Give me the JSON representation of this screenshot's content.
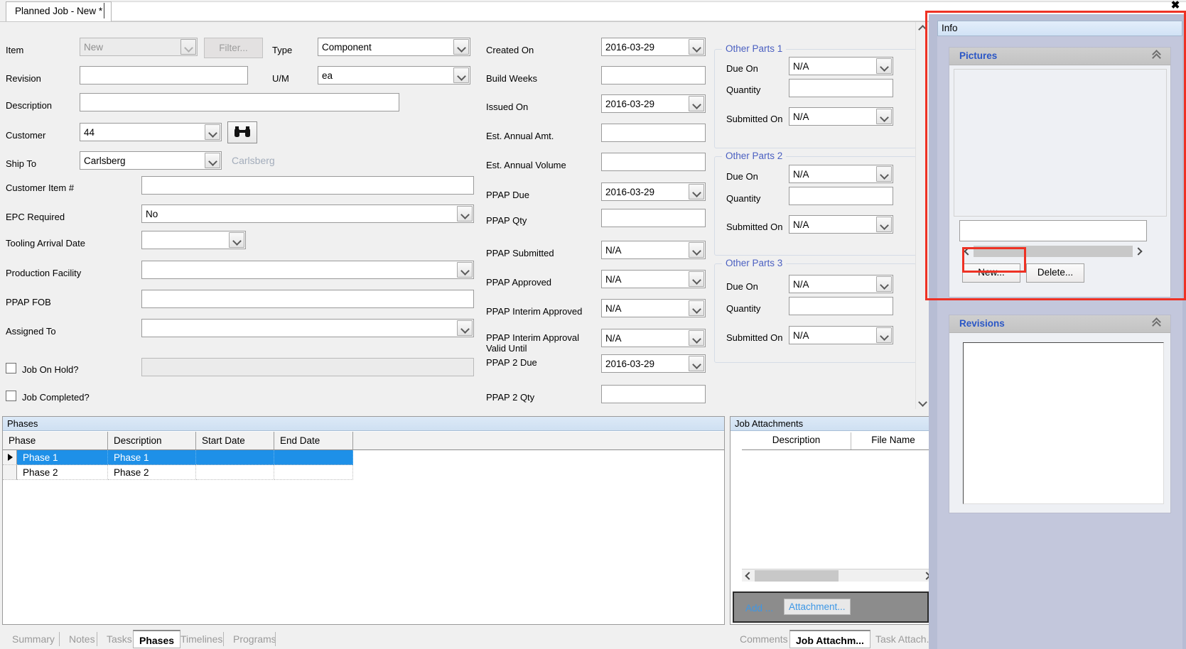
{
  "window": {
    "tab_title": "Planned Job - New *",
    "close_icon": "close-icon"
  },
  "form": {
    "left_fields": [
      {
        "label": "Item",
        "value": "New",
        "type": "combo",
        "disabled": true
      },
      {
        "label": "Revision",
        "value": "",
        "type": "text"
      },
      {
        "label": "Description",
        "value": "",
        "type": "text"
      },
      {
        "label": "Customer",
        "value": "44",
        "type": "combo"
      },
      {
        "label": "Ship To",
        "value": "Carlsberg",
        "type": "combo"
      },
      {
        "label": "Customer Item #",
        "value": "",
        "type": "text"
      },
      {
        "label": "EPC Required",
        "value": "No",
        "type": "combo"
      },
      {
        "label": "Tooling Arrival Date",
        "value": "",
        "type": "combo"
      },
      {
        "label": "Production Facility",
        "value": "",
        "type": "combo"
      },
      {
        "label": "PPAP FOB",
        "value": "",
        "type": "text"
      },
      {
        "label": "Assigned To",
        "value": "",
        "type": "combo"
      },
      {
        "label": "Job On Hold?",
        "value": "",
        "type": "checkbox"
      },
      {
        "label": "Job Completed?",
        "value": "",
        "type": "checkbox"
      }
    ],
    "filter_button": "Filter...",
    "ship_to_hint": "Carlsberg",
    "find_icon": "binoculars-icon",
    "mid_fields": [
      {
        "label": "Type",
        "value": "Component",
        "type": "combo"
      },
      {
        "label": "U/M",
        "value": "ea",
        "type": "combo"
      }
    ],
    "right_fields": [
      {
        "label": "Created On",
        "value": "2016-03-29",
        "type": "combo"
      },
      {
        "label": "Build Weeks",
        "value": "",
        "type": "text"
      },
      {
        "label": "Issued On",
        "value": "2016-03-29",
        "type": "combo"
      },
      {
        "label": "Est. Annual Amt.",
        "value": "",
        "type": "text"
      },
      {
        "label": "Est. Annual Volume",
        "value": "",
        "type": "text"
      },
      {
        "label": "PPAP Due",
        "value": "2016-03-29",
        "type": "combo"
      },
      {
        "label": "PPAP Qty",
        "value": "",
        "type": "text"
      },
      {
        "label": "PPAP Submitted",
        "value": "N/A",
        "type": "combo"
      },
      {
        "label": "PPAP Approved",
        "value": "N/A",
        "type": "combo"
      },
      {
        "label": "PPAP Interim Approved",
        "value": "N/A",
        "type": "combo"
      },
      {
        "label": "PPAP Interim Approval Valid Until",
        "value": "N/A",
        "type": "combo"
      },
      {
        "label": "PPAP 2 Due",
        "value": "2016-03-29",
        "type": "combo"
      },
      {
        "label": "PPAP 2 Qty",
        "value": "",
        "type": "text"
      }
    ],
    "other_parts": [
      {
        "title": "Other Parts 1",
        "rows": [
          {
            "label": "Due On",
            "value": "N/A",
            "type": "combo"
          },
          {
            "label": "Quantity",
            "value": "",
            "type": "text"
          },
          {
            "label": "Submitted On",
            "value": "N/A",
            "type": "combo"
          }
        ]
      },
      {
        "title": "Other Parts 2",
        "rows": [
          {
            "label": "Due On",
            "value": "N/A",
            "type": "combo"
          },
          {
            "label": "Quantity",
            "value": "",
            "type": "text"
          },
          {
            "label": "Submitted On",
            "value": "N/A",
            "type": "combo"
          }
        ]
      },
      {
        "title": "Other Parts 3",
        "rows": [
          {
            "label": "Due On",
            "value": "N/A",
            "type": "combo"
          },
          {
            "label": "Quantity",
            "value": "",
            "type": "text"
          },
          {
            "label": "Submitted On",
            "value": "N/A",
            "type": "combo"
          }
        ]
      }
    ]
  },
  "phases": {
    "caption": "Phases",
    "columns": [
      "Phase",
      "Description",
      "Start Date",
      "End Date"
    ],
    "rows": [
      {
        "phase": "Phase 1",
        "description": "Phase 1",
        "start_date": "",
        "end_date": "",
        "selected": true
      },
      {
        "phase": "Phase 2",
        "description": "Phase 2",
        "start_date": "",
        "end_date": "",
        "selected": false
      }
    ],
    "tabs": [
      {
        "label": "Summary",
        "active": false
      },
      {
        "label": "Notes",
        "active": false
      },
      {
        "label": "Tasks",
        "active": false
      },
      {
        "label": "Phases",
        "active": true
      },
      {
        "label": "Timelines",
        "active": false
      },
      {
        "label": "Programs",
        "active": false
      }
    ]
  },
  "job_attachments": {
    "caption": "Job Attachments",
    "columns": [
      "Description",
      "File Name"
    ],
    "rows": [],
    "footer_buttons": [
      "Add ...",
      "Attachment..."
    ],
    "tabs": [
      {
        "label": "Comments",
        "active": false
      },
      {
        "label": "Job Attachm...",
        "active": true
      },
      {
        "label": "Task Attach...",
        "active": false
      }
    ]
  },
  "info_panel": {
    "caption": "Info",
    "sections": [
      {
        "title": "Pictures",
        "collapse_icon": "chevron-double-up-icon",
        "picture_name": "",
        "buttons": [
          "New...",
          "Delete..."
        ]
      },
      {
        "title": "Revisions",
        "collapse_icon": "chevron-double-up-icon"
      }
    ]
  },
  "colors": {
    "highlight_red": "#ee3124",
    "selection_blue": "#1e90e8",
    "group_label_blue": "#4a5fc1",
    "section_title_blue": "#2a56c6",
    "link_blue": "#3d97e6"
  }
}
